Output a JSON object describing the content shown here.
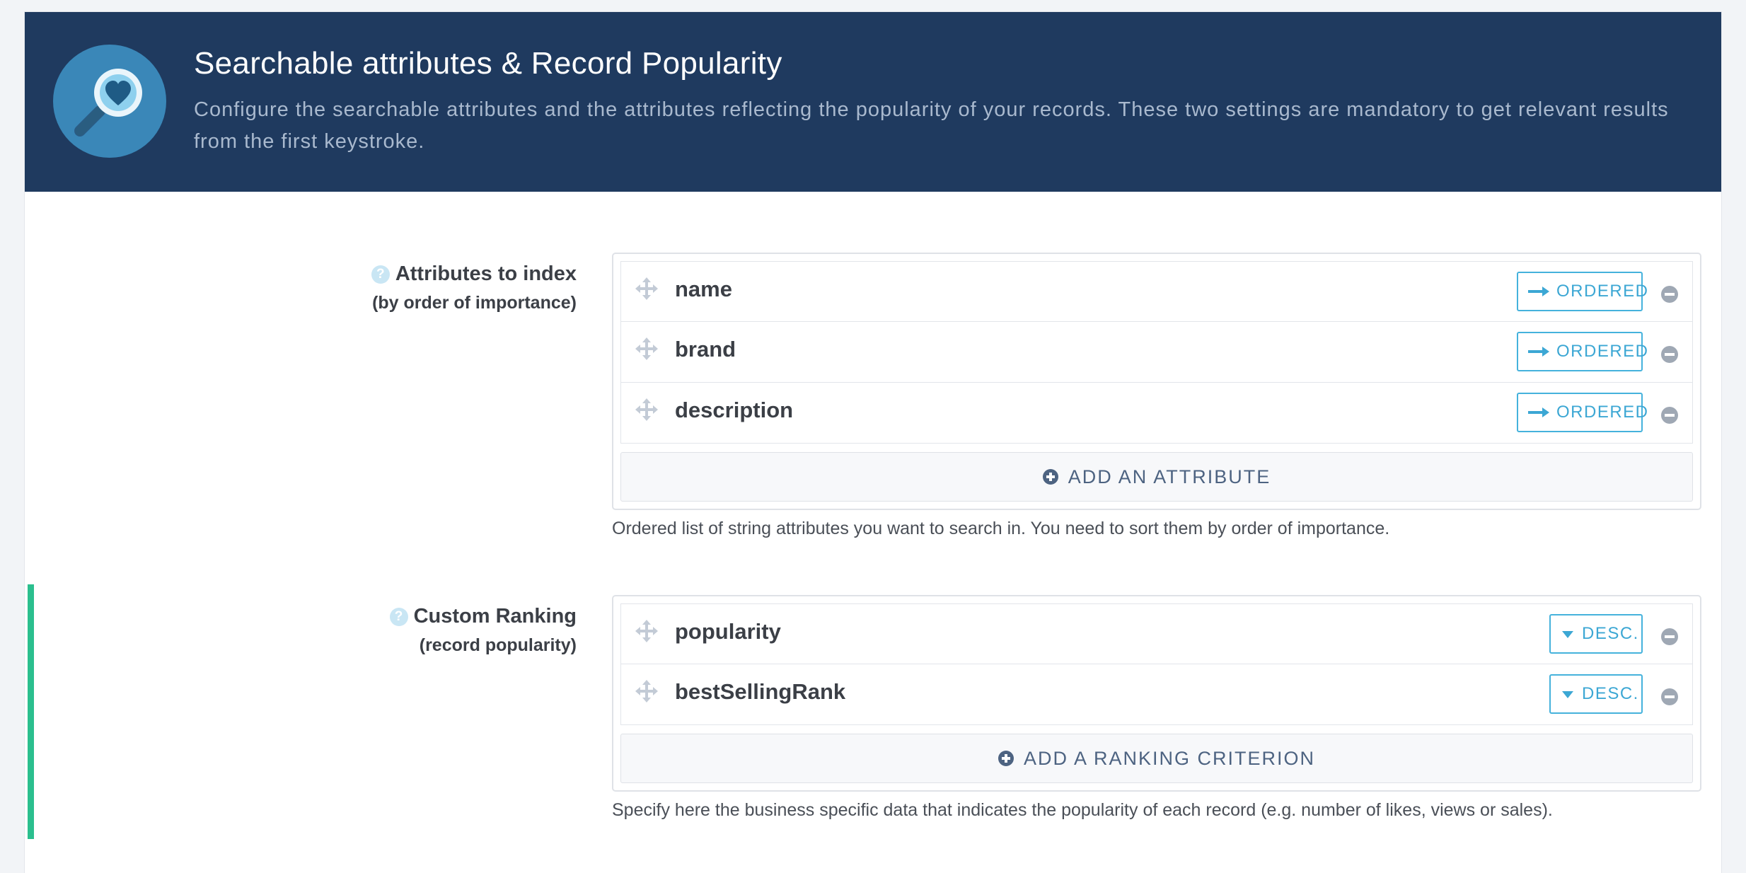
{
  "header": {
    "title": "Searchable attributes & Record Popularity",
    "description": "Configure the searchable attributes and the attributes reflecting the popularity of your records. These two settings are mandatory to get relevant results from the first keystroke.",
    "icon": "magnifier-heart-icon",
    "background_color": "#1f3a5f"
  },
  "attributes_section": {
    "label": "Attributes to index",
    "sublabel": "(by order of importance)",
    "items": [
      {
        "name": "name",
        "order_label": "ORDERED"
      },
      {
        "name": "brand",
        "order_label": "ORDERED"
      },
      {
        "name": "description",
        "order_label": "ORDERED"
      }
    ],
    "add_label": "ADD AN ATTRIBUTE",
    "help": "Ordered list of string attributes you want to search in. You need to sort them by order of importance."
  },
  "ranking_section": {
    "label": "Custom Ranking",
    "sublabel": "(record popularity)",
    "items": [
      {
        "name": "popularity",
        "order_label": "DESC."
      },
      {
        "name": "bestSellingRank",
        "order_label": "DESC."
      }
    ],
    "add_label": "ADD A RANKING CRITERION",
    "help": "Specify here the business specific data that indicates the popularity of each record (e.g. number of likes, views or sales).",
    "accent_color": "#2bbf8e"
  },
  "colors": {
    "accent_blue": "#3ca7d4",
    "remove_gray": "#9fa8b4"
  }
}
